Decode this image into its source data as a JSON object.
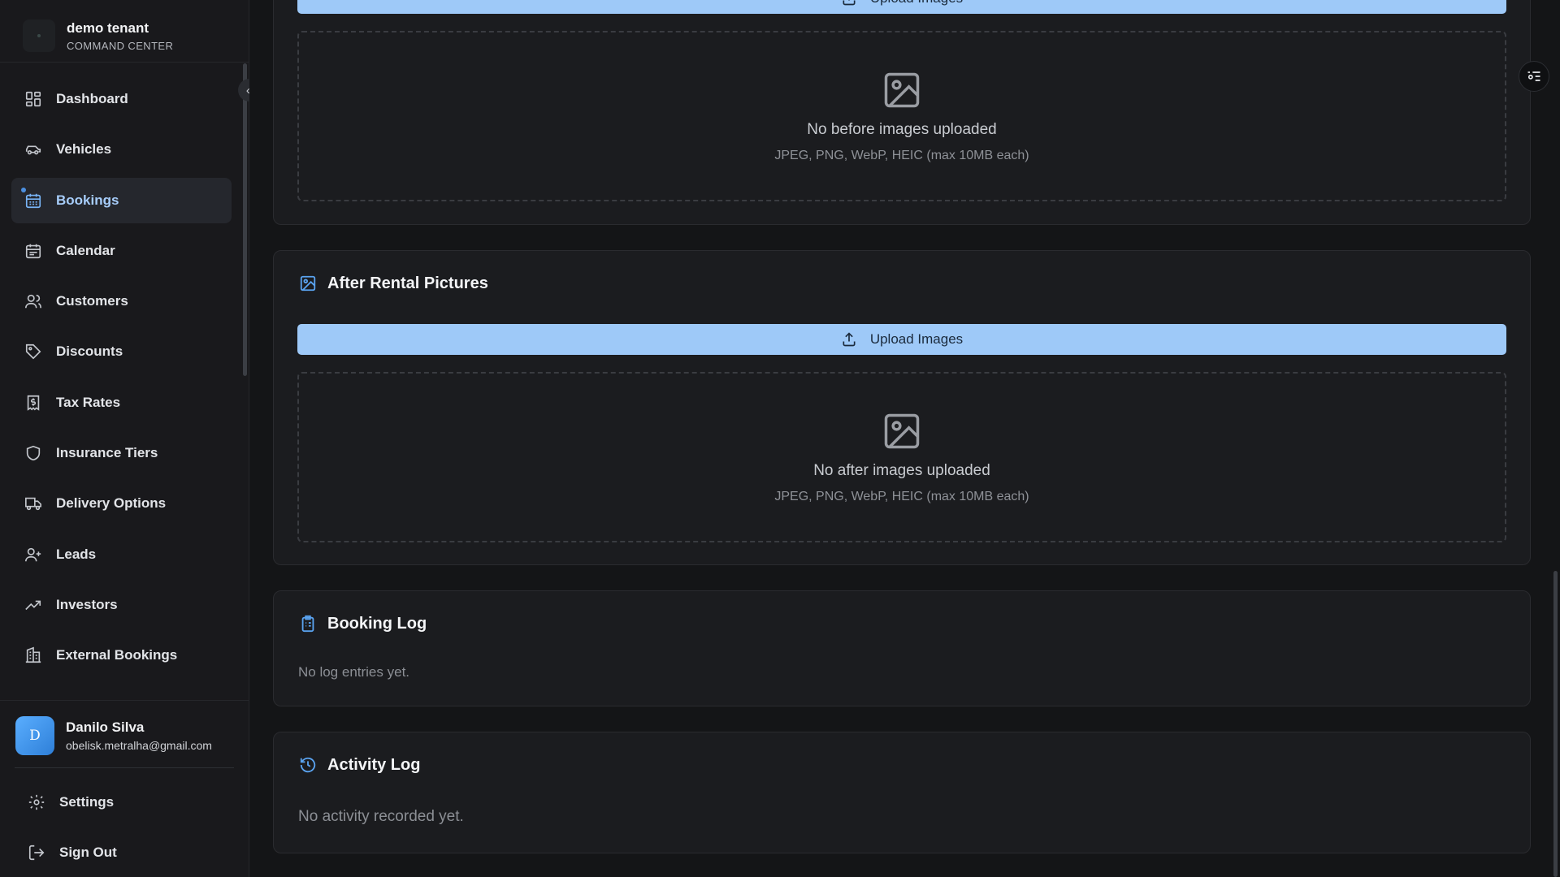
{
  "brand": {
    "name": "demo tenant",
    "subtitle": "COMMAND CENTER"
  },
  "sidebar": {
    "collapse_label": "«",
    "items": [
      {
        "label": "Dashboard",
        "icon": "dashboard-icon"
      },
      {
        "label": "Vehicles",
        "icon": "car-icon"
      },
      {
        "label": "Bookings",
        "icon": "calendar-grid-icon",
        "active": true
      },
      {
        "label": "Calendar",
        "icon": "calendar-icon"
      },
      {
        "label": "Customers",
        "icon": "users-icon"
      },
      {
        "label": "Discounts",
        "icon": "tag-icon"
      },
      {
        "label": "Tax Rates",
        "icon": "receipt-icon"
      },
      {
        "label": "Insurance Tiers",
        "icon": "shield-icon"
      },
      {
        "label": "Delivery Options",
        "icon": "truck-icon"
      },
      {
        "label": "Leads",
        "icon": "user-plus-icon"
      },
      {
        "label": "Investors",
        "icon": "trending-up-icon"
      },
      {
        "label": "External Bookings",
        "icon": "building-icon"
      }
    ]
  },
  "user": {
    "initial": "D",
    "name": "Danilo Silva",
    "email": "obelisk.metralha@gmail.com"
  },
  "bottom": {
    "settings_label": "Settings",
    "signout_label": "Sign Out"
  },
  "before": {
    "upload_label": "Upload Images",
    "empty_title": "No before images uploaded",
    "empty_hint": "JPEG, PNG, WebP, HEIC (max 10MB each)"
  },
  "after": {
    "title": "After Rental Pictures",
    "upload_label": "Upload Images",
    "empty_title": "No after images uploaded",
    "empty_hint": "JPEG, PNG, WebP, HEIC (max 10MB each)"
  },
  "booking_log": {
    "title": "Booking Log",
    "empty": "No log entries yet."
  },
  "activity_log": {
    "title": "Activity Log",
    "empty": "No activity recorded yet."
  },
  "colors": {
    "accent": "#9ec9f8",
    "active_text": "#a7cdfa",
    "background": "#141517",
    "card": "#1b1c1f"
  }
}
